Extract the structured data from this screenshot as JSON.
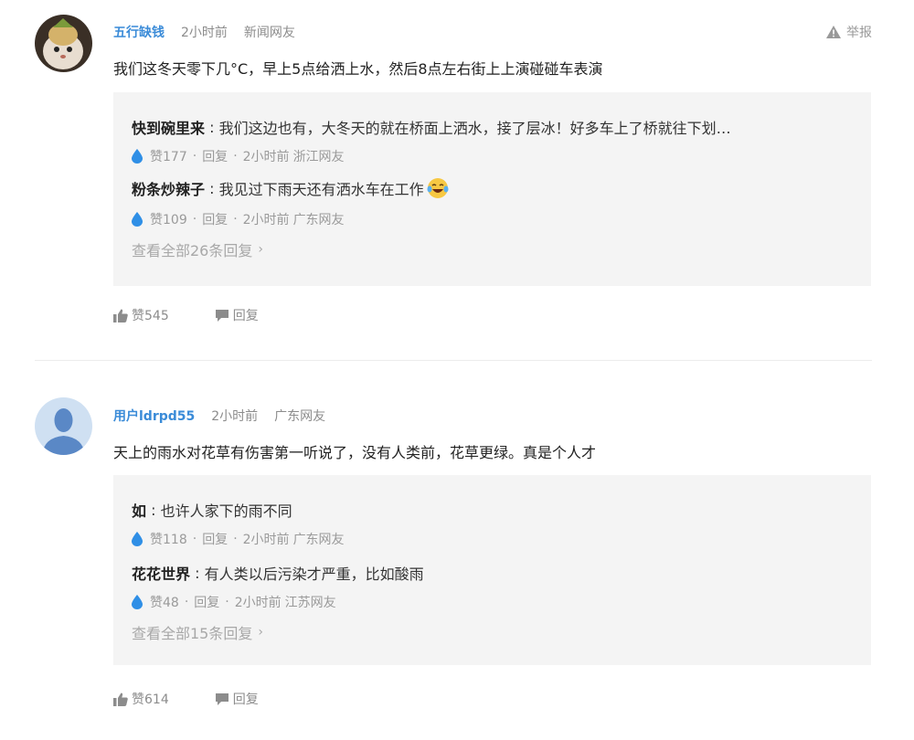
{
  "comments": [
    {
      "username": "五行缺钱",
      "time": "2小时前",
      "location": "新闻网友",
      "report_label": "举报",
      "content": "我们这冬天零下几°C，早上5点给洒上水，然后8点左右街上上演碰碰车表演",
      "replies": [
        {
          "author": "快到碗里来",
          "text": "我们这边也有，大冬天的就在桥面上洒水，接了层冰！好多车上了桥就往下划…",
          "likes": "赞177",
          "reply_label": "回复",
          "time": "2小时前",
          "location": "浙江网友"
        },
        {
          "author": "粉条炒辣子",
          "text": "我见过下雨天还有洒水车在工作",
          "likes": "赞109",
          "reply_label": "回复",
          "time": "2小时前",
          "location": "广东网友"
        }
      ],
      "view_all": "查看全部26条回复",
      "likes": "赞545",
      "reply_label": "回复"
    },
    {
      "username": "用户ldrpd55",
      "time": "2小时前",
      "location": "广东网友",
      "content": "天上的雨水对花草有伤害第一听说了，没有人类前，花草更绿。真是个人才",
      "replies": [
        {
          "author": "如",
          "text": "也许人家下的雨不同",
          "likes": "赞118",
          "reply_label": "回复",
          "time": "2小时前",
          "location": "广东网友"
        },
        {
          "author": "花花世界",
          "text": "有人类以后污染才严重，比如酸雨",
          "likes": "赞48",
          "reply_label": "回复",
          "time": "2小时前",
          "location": "江苏网友"
        }
      ],
      "view_all": "查看全部15条回复",
      "likes": "赞614",
      "reply_label": "回复"
    }
  ],
  "colors": {
    "username": "#3a8bd8",
    "drop": "#2f8fe6",
    "reply_bg": "#f4f4f4",
    "meta": "#8c8c8c"
  },
  "icons": {
    "report": "warning-icon",
    "like": "thumbs-up-icon",
    "reply": "speech-bubble-icon",
    "reply_like": "water-drop-icon",
    "laugh": "laughing-tears-emoji"
  }
}
